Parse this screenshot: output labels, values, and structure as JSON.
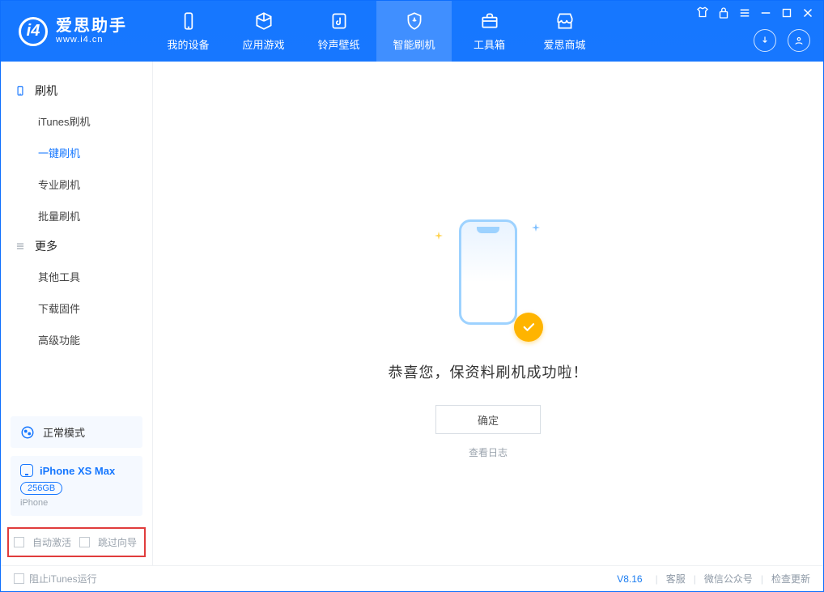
{
  "app": {
    "name_cn": "爱思助手",
    "name_en": "www.i4.cn"
  },
  "header_tabs": [
    {
      "label": "我的设备",
      "icon": "device"
    },
    {
      "label": "应用游戏",
      "icon": "cube"
    },
    {
      "label": "铃声壁纸",
      "icon": "music"
    },
    {
      "label": "智能刷机",
      "icon": "shield",
      "active": true
    },
    {
      "label": "工具箱",
      "icon": "toolbox"
    },
    {
      "label": "爱思商城",
      "icon": "store"
    }
  ],
  "sidebar": {
    "sections": [
      {
        "title": "刷机",
        "icon": "phone",
        "items": [
          {
            "label": "iTunes刷机"
          },
          {
            "label": "一键刷机",
            "active": true
          },
          {
            "label": "专业刷机"
          },
          {
            "label": "批量刷机"
          }
        ]
      },
      {
        "title": "更多",
        "icon": "list",
        "items": [
          {
            "label": "其他工具"
          },
          {
            "label": "下载固件"
          },
          {
            "label": "高级功能"
          }
        ]
      }
    ],
    "mode": "正常模式",
    "device": {
      "name": "iPhone XS Max",
      "storage": "256GB",
      "type": "iPhone"
    },
    "options": {
      "auto_activate": "自动激活",
      "skip_guide": "跳过向导"
    }
  },
  "main": {
    "message": "恭喜您，保资料刷机成功啦！",
    "ok": "确定",
    "view_log": "查看日志"
  },
  "footer": {
    "block_itunes": "阻止iTunes运行",
    "version": "V8.16",
    "links": [
      "客服",
      "微信公众号",
      "检查更新"
    ]
  }
}
